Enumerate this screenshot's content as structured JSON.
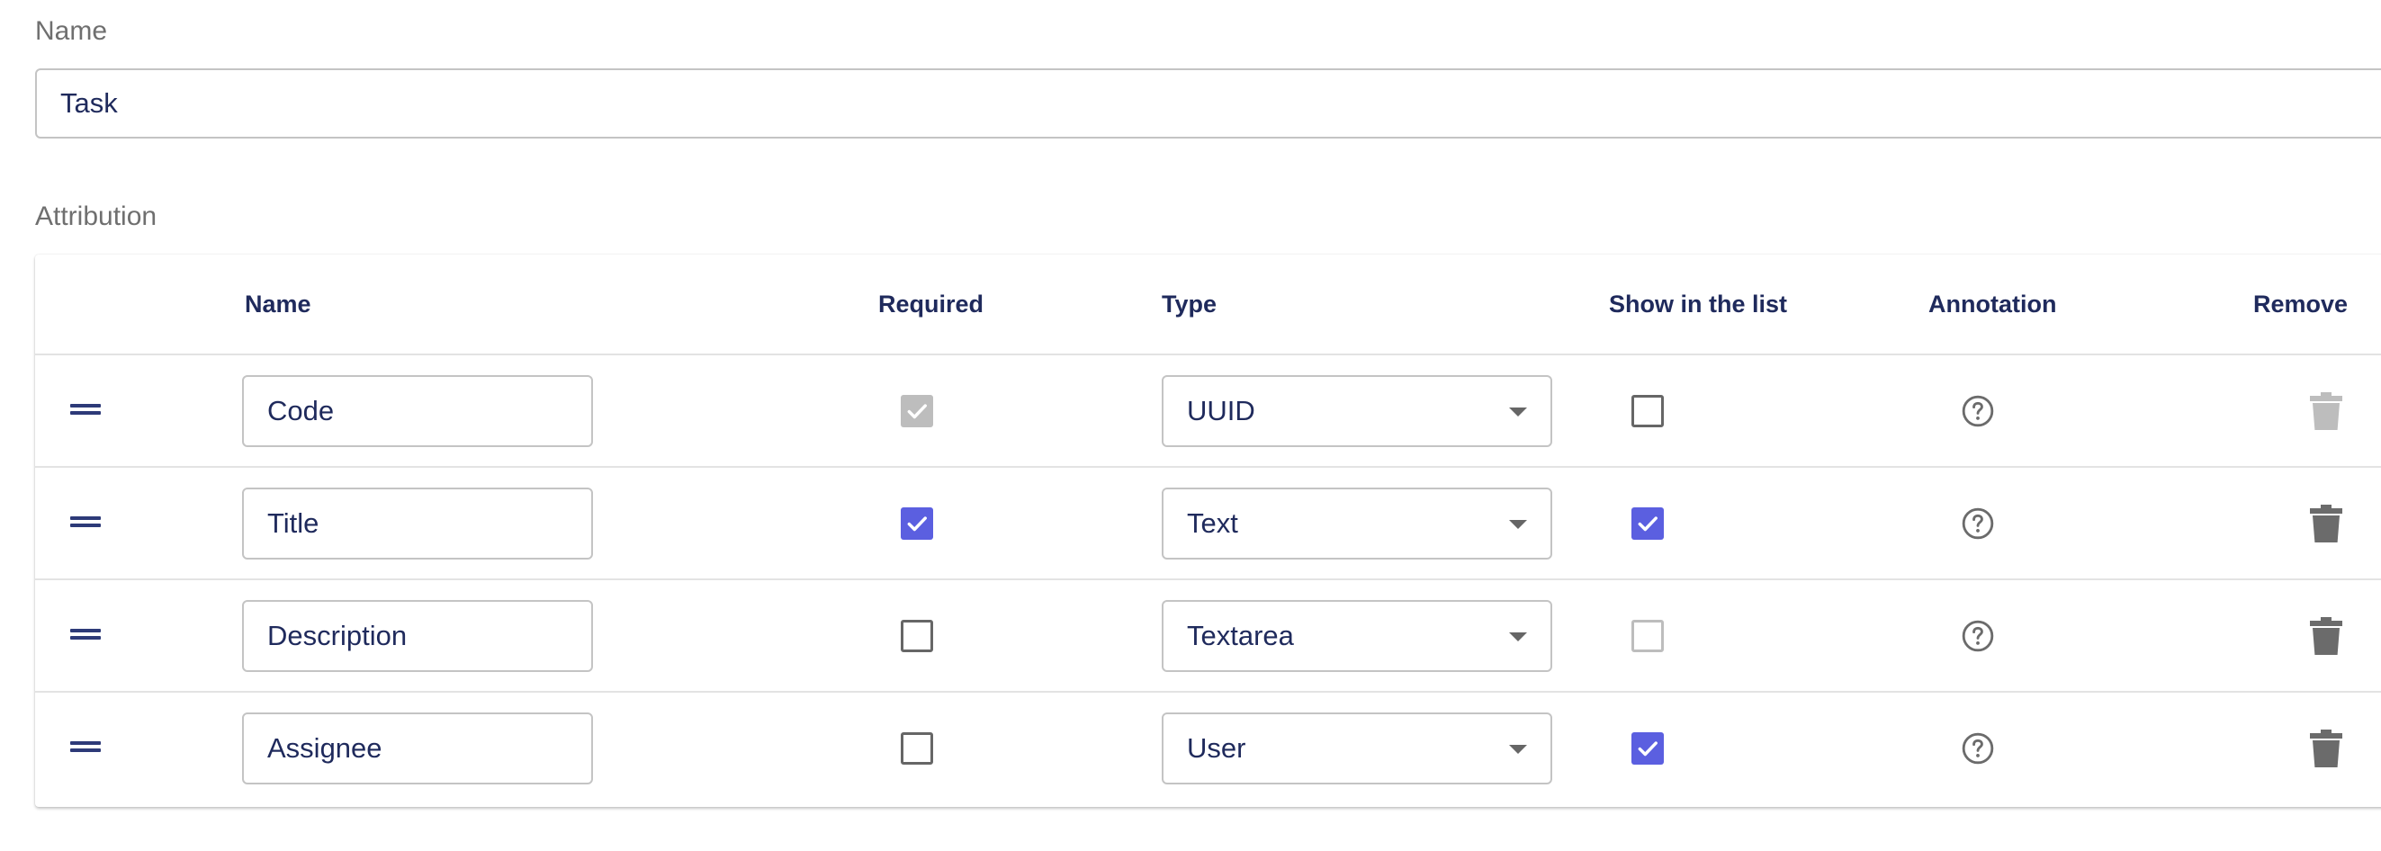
{
  "form": {
    "name_label": "Name",
    "name_value": "Task",
    "attribution_label": "Attribution"
  },
  "table": {
    "headers": {
      "name": "Name",
      "required": "Required",
      "type": "Type",
      "show_in_list": "Show in the list",
      "annotation": "Annotation",
      "remove": "Remove"
    },
    "rows": [
      {
        "name": "Code",
        "required": true,
        "required_disabled": true,
        "type": "UUID",
        "show_in_list": false,
        "show_disabled": false,
        "remove_disabled": true
      },
      {
        "name": "Title",
        "required": true,
        "required_disabled": false,
        "type": "Text",
        "show_in_list": true,
        "show_disabled": false,
        "remove_disabled": false
      },
      {
        "name": "Description",
        "required": false,
        "required_disabled": false,
        "type": "Textarea",
        "show_in_list": false,
        "show_disabled": true,
        "remove_disabled": false
      },
      {
        "name": "Assignee",
        "required": false,
        "required_disabled": false,
        "type": "User",
        "show_in_list": true,
        "show_disabled": false,
        "remove_disabled": false
      }
    ]
  },
  "colors": {
    "accent": "#5b5fe0",
    "text": "#1f2a5c",
    "muted_label": "#6f6f6f",
    "disabled": "#bdbdbd",
    "icon_gray": "#6b6b6b"
  },
  "icons": {
    "drag": "drag-handle-icon",
    "annotation": "help-circle-icon",
    "remove": "trash-icon",
    "select": "chevron-down-icon",
    "check": "check-icon"
  }
}
